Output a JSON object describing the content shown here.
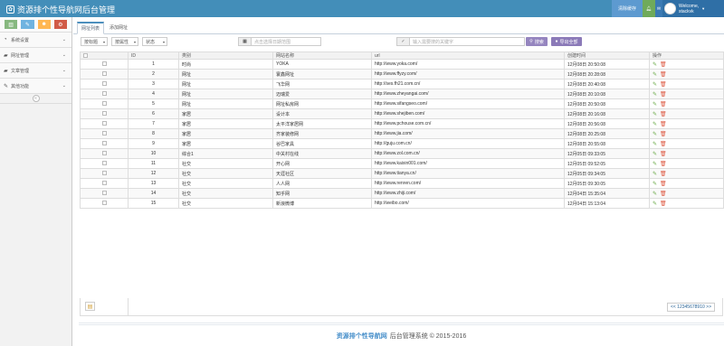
{
  "header": {
    "title": "资源排个性导航网后台管理",
    "clear_cache": "清除缓存",
    "welcome": "Welcome,",
    "username": "stackvk"
  },
  "colors": {
    "primary": "#438eb9",
    "edit": "#69aa46",
    "delete": "#dd5a43"
  },
  "sidebar": {
    "shortcuts": [
      "chart-icon",
      "pencil-icon",
      "users-icon",
      "cogs-icon"
    ],
    "items": [
      {
        "label": "系统设置",
        "icon": "tachometer-icon"
      },
      {
        "label": "网址管理",
        "icon": "folder-icon"
      },
      {
        "label": "文章管理",
        "icon": "folder-icon"
      },
      {
        "label": "其他功能",
        "icon": "pencil-icon"
      }
    ]
  },
  "tabs": [
    "网址列表",
    "添加网址"
  ],
  "filters": {
    "sel1": "按标题",
    "sel2": "按属性",
    "sel3": "状态",
    "date_placeholder": "点击选择日期范围",
    "kw_placeholder": "输入需要搜的关键字",
    "search_btn": "搜索",
    "export_btn": "导出全部"
  },
  "table": {
    "headers": [
      "",
      "ID",
      "类别",
      "网站名称",
      "url",
      "创建时间",
      "操作"
    ],
    "rows": [
      [
        "1",
        "时尚",
        "YOKA",
        "http://www.yoka.com/",
        "12月08日 20:50:08"
      ],
      [
        "2",
        "网址",
        "寰鑫网址",
        "http://www.ffyzy.com/",
        "12月08日 20:28:08"
      ],
      [
        "3",
        "网址",
        "飞华网",
        "http://ses.fh21.com.cn/",
        "12月08日 20:40:08"
      ],
      [
        "4",
        "网址",
        "迈瑞爱",
        "http://www.zheyangai.com/",
        "12月08日 20:10:08"
      ],
      [
        "5",
        "网址",
        "网址私房网",
        "http://www.sifangseo.com/",
        "12月08日 20:50:08"
      ],
      [
        "6",
        "家居",
        "设计本",
        "http://www.shejiben.com/",
        "12月08日 20:16:08"
      ],
      [
        "7",
        "家居",
        "太平洋家居网",
        "http://www.pchouse.com.cn/",
        "12月08日 20:56:08"
      ],
      [
        "8",
        "家居",
        "齐家装修网",
        "http://www.jia.com/",
        "12月08日 20:25:08"
      ],
      [
        "9",
        "家居",
        "谷巴家具",
        "http://guju.com.cn/",
        "12月08日 20:55:08"
      ],
      [
        "10",
        "综合1",
        "中关村在线",
        "http://www.zol.com.cn/",
        "12月05日 09:33:05"
      ],
      [
        "11",
        "社交",
        "开心网",
        "http://www.kaixin001.com/",
        "12月05日 09:52:05"
      ],
      [
        "12",
        "社交",
        "天涯社区",
        "http://www.tianya.cn/",
        "12月05日 09:34:05"
      ],
      [
        "13",
        "社交",
        "人人网",
        "http://www.renren.com/",
        "12月05日 09:30:05"
      ],
      [
        "14",
        "社交",
        "知乎网",
        "http://www.zhiji.com/",
        "12月04日 15:35:04"
      ],
      [
        "15",
        "社交",
        "新浪微博",
        "http://weibo.com/",
        "12月04日 15:13:04"
      ]
    ]
  },
  "pager": "<< 12345678910 >>",
  "footer": {
    "brand": "资源排个性导航网",
    "text": "后台管理系统 © 2015-2016"
  }
}
